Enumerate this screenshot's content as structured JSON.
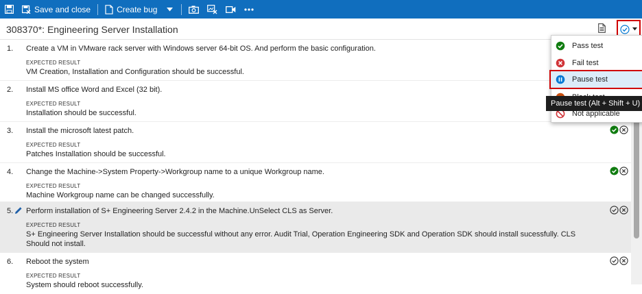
{
  "toolbar": {
    "save_close_label": "Save and close",
    "create_bug_label": "Create bug"
  },
  "header": {
    "title": "308370*: Engineering Server Installation"
  },
  "steps": [
    {
      "number": "1.",
      "action": "Create a VM in VMware rack server with Windows server 64-bit OS. And perform the basic configuration.",
      "expected_label": "EXPECTED RESULT",
      "expected": "VM Creation, Installation and Configuration should be successful.",
      "status": "none"
    },
    {
      "number": "2.",
      "action": "Install MS office Word and Excel (32 bit).",
      "expected_label": "EXPECTED RESULT",
      "expected": "Installation should be successful.",
      "status": "none"
    },
    {
      "number": "3.",
      "action": "Install the microsoft latest patch.",
      "expected_label": "EXPECTED RESULT",
      "expected": "Patches Installation should be successful.",
      "status": "passed"
    },
    {
      "number": "4.",
      "action": "Change the Machine->System Property->Workgroup name to a unique Workgroup name.",
      "expected_label": "EXPECTED RESULT",
      "expected": "Machine Workgroup name can be changed successfully.",
      "status": "passed"
    },
    {
      "number": "5.",
      "action": "Perform installation of S+ Engineering Server 2.4.2 in the Machine.UnSelect CLS as Server.",
      "expected_label": "EXPECTED RESULT",
      "expected": "S+ Engineering Server Installation should be successful without any error. Audit Trial, Operation Engineering SDK and Operation SDK should install sucessfully. CLS Should not install.",
      "status": "unset"
    },
    {
      "number": "6.",
      "action": "Reboot the system",
      "expected_label": "EXPECTED RESULT",
      "expected": "System should reboot successfully.",
      "status": "unset"
    }
  ],
  "outcome_menu": {
    "items": [
      {
        "label": "Pass test",
        "icon": "pass-icon"
      },
      {
        "label": "Fail test",
        "icon": "fail-icon"
      },
      {
        "label": "Pause test",
        "icon": "pause-icon"
      },
      {
        "label": "Block test",
        "icon": "block-icon"
      },
      {
        "label": "Not applicable",
        "icon": "not-applicable-icon"
      }
    ],
    "tooltip": "Pause test (Alt + Shift + U)"
  },
  "colors": {
    "toolbar": "#106ebe",
    "pass": "#107c10",
    "fail": "#d13438",
    "pause": "#0078d4",
    "highlight_border": "#d00000"
  }
}
